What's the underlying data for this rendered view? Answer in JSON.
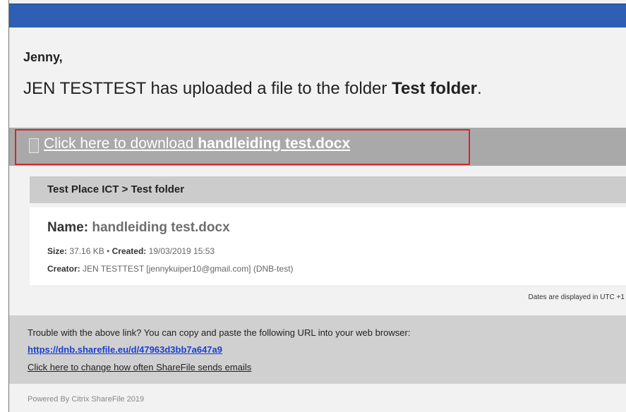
{
  "email": {
    "greeting": "Jenny,",
    "upload_msg_prefix": "JEN TESTTEST has uploaded a file to the folder ",
    "folder_name": "Test folder",
    "upload_msg_suffix": ".",
    "download": {
      "prefix": "Click here to download ",
      "file_name": "handleiding test.docx"
    },
    "breadcrumb": "Test Place ICT > Test folder",
    "file": {
      "name_label": "Name:",
      "name_value": "handleiding test.docx",
      "size_label": "Size:",
      "size_value": "37.16 KB",
      "separator": "•",
      "created_label": "Created:",
      "created_value": "19/03/2019 15:53",
      "creator_label": "Creator:",
      "creator_value": "JEN TESTTEST [jennykuiper10@gmail.com] (DNB-test)"
    },
    "utc_note": "Dates are displayed in UTC +1",
    "trouble": {
      "text": "Trouble with the above link? You can copy and paste the following URL into your web browser:",
      "url": "https://dnb.sharefile.eu/d/47963d3bb7a647a9",
      "change_link": "Click here to change how often ShareFile sends emails"
    },
    "powered_by": "Powered By Citrix ShareFile 2019"
  },
  "colors": {
    "header_bar": "#2f5eb5",
    "download_bar": "#a9a9a9",
    "highlight": "#d6262b",
    "link": "#1a3fd0"
  },
  "icons": {
    "download_icon": "document-icon"
  }
}
